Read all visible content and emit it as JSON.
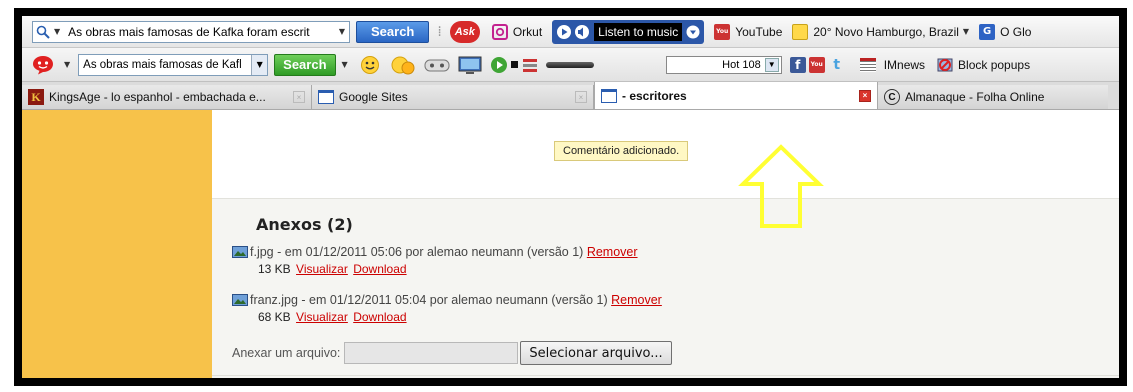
{
  "toolbar1": {
    "search_text": "As obras mais famosas de Kafka foram escrit",
    "search_button": "Search",
    "ask_label": "Ask",
    "orkut_label": "Orkut",
    "music_label": "Listen to music",
    "youtube_label": "YouTube",
    "weather_label": "20° Novo Hamburgo, Brazil",
    "globo_label": "O Glo"
  },
  "toolbar2": {
    "search_text": "As obras mais famosas de Kafl",
    "search_button": "Search",
    "hot_label": "Hot 108",
    "imnews_label": "IMnews",
    "popups_label": "Block popups"
  },
  "tabs": [
    {
      "label": "KingsAge - lo espanhol - embachada e...",
      "close": "×"
    },
    {
      "label": "Google Sites",
      "close": "×"
    },
    {
      "label": "- escritores",
      "close": "×"
    },
    {
      "label": "Almanaque - Folha Online"
    }
  ],
  "tooltip": "Comentário adicionado.",
  "attachments": {
    "title": "Anexos (2)",
    "items": [
      {
        "name": "f.jpg",
        "info": " - em 01/12/2011 05:06 por alemao neumann (versão 1)",
        "remove": "Remover",
        "size": "13 KB",
        "view": "Visualizar",
        "download": "Download"
      },
      {
        "name": "franz.jpg",
        "info": " - em 01/12/2011 05:04 por alemao neumann (versão 1)",
        "remove": "Remover",
        "size": "68 KB",
        "view": "Visualizar",
        "download": "Download"
      }
    ],
    "attach_label": "Anexar um arquivo:",
    "select_button": "Selecionar arquivo..."
  },
  "colors": {
    "sidebar": "#f7c24a",
    "arrow": "#ffff33",
    "link": "#cc0000"
  }
}
